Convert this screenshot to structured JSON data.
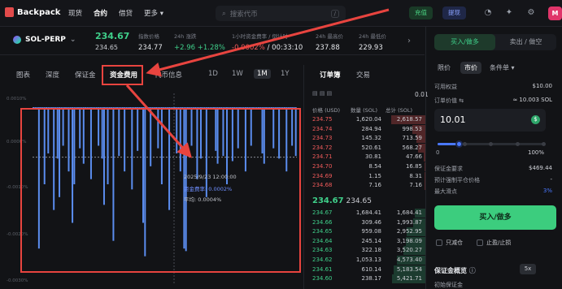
{
  "topbar": {
    "logo": "Backpack",
    "nav": [
      "现货",
      "合约",
      "借贷",
      "更多"
    ],
    "nav_active": 1,
    "search_placeholder": "搜索代币",
    "search_shortcut": "/",
    "deposit": "充值",
    "withdraw": "提现",
    "avatar": "M"
  },
  "market": {
    "symbol": "SOL-PERP",
    "last_price": "234.67",
    "mark_price": "234.65",
    "stats": [
      {
        "label": "指数价格",
        "value": "234.77",
        "tone": "normal"
      },
      {
        "label": "24h 涨跌",
        "value": "+2.96 +1.28%",
        "tone": "green"
      },
      {
        "label": "1小时资金费率 / 倒计时",
        "value": "-0.0002% / 00:33:10",
        "tone": "mixed"
      },
      {
        "label": "24h 最高价",
        "value": "237.88",
        "tone": "normal"
      },
      {
        "label": "24h 最低价",
        "value": "229.93",
        "tone": "normal"
      }
    ],
    "funding_rate": "-0.0002%",
    "countdown": "/ 00:33:10"
  },
  "chart_tabs": {
    "tabs": [
      "图表",
      "深度",
      "保证金",
      "资金费用",
      "代币信息"
    ],
    "active": 3,
    "timeframes": [
      "1D",
      "1W",
      "1M",
      "1Y"
    ],
    "active_tf": 2
  },
  "chart": {
    "y_labels": [
      "0.0010%",
      "0.0000%",
      "-0.0010%",
      "-0.0020%",
      "-0.0030%"
    ],
    "tooltip": {
      "date": "2025/9/23 12:00:00",
      "rate": "资金费率: 0.0002%",
      "avg": "平均: 0.0004%"
    }
  },
  "chart_data": {
    "type": "bar",
    "title": "",
    "xlabel": "",
    "ylabel": "",
    "ylim": [
      -0.005,
      0.001
    ],
    "baseline_note": "",
    "series": [
      {
        "values": [
          0.001,
          0.001,
          0.001,
          -0.0045,
          0.001,
          0.001,
          -0.002,
          0.001,
          -0.0008,
          0.001,
          0.001,
          -0.003,
          0.001,
          -0.001,
          -0.0025,
          0.001,
          -0.0005,
          0.001,
          0.001,
          -0.0015,
          0.001,
          -0.0035,
          -0.002,
          0.001,
          0.001,
          -0.0006,
          0.001,
          -0.0012,
          0.001,
          0.001,
          0.001,
          -0.0018,
          0.001,
          0.001,
          0.001,
          -0.0005,
          0.001,
          -0.001,
          -0.0028,
          0.001,
          -0.002,
          0.001,
          0.001,
          -0.0042,
          0.001,
          0.001,
          -0.0009,
          0.001,
          0.001,
          -0.0015,
          0.001,
          0.001,
          0.001,
          -0.0022,
          0.001,
          0.001,
          -0.0007,
          0.001,
          0.001,
          -0.0035,
          -0.0048,
          0.001,
          0.001,
          -0.0013,
          0.001,
          0.001,
          0.001,
          -0.0006,
          0.001,
          -0.002,
          0.001,
          0.001,
          0.001,
          -0.003,
          0.001,
          0.001,
          0.001,
          -0.0008,
          0.001,
          -0.0015,
          0.001,
          -0.0045,
          -0.0046,
          0.001,
          0.001,
          -0.0005,
          0.001,
          0.001,
          -0.0018,
          0.001,
          -0.001,
          0.001,
          0.001,
          -0.0025,
          0.001,
          0.001,
          0.001,
          0.001,
          -0.0007,
          -0.0012,
          0.001,
          0.001,
          -0.0009,
          0.001,
          -0.002,
          0.001,
          0.001,
          -0.0011,
          0.001,
          0.001,
          -0.0006,
          0.001,
          0.001,
          0.001,
          -0.0015,
          0.001,
          0.001,
          -0.0005,
          0.001,
          0.001,
          0.001,
          0.001,
          0.001,
          -0.0008,
          -0.0012,
          0.001,
          0.001,
          0.001,
          0.001,
          -0.0006,
          0.001,
          0.001,
          -0.001,
          0.001,
          0.001,
          0.001,
          -0.0015,
          0.001,
          0.001,
          -0.0005,
          0.001,
          -0.0009
        ]
      }
    ]
  },
  "orderbook": {
    "tabs": [
      "订单簿",
      "交易"
    ],
    "precision": "0.01",
    "headers": [
      "价格 (USD)",
      "数量 (SOL)",
      "总计 (SOL)"
    ],
    "asks": [
      {
        "price": "234.75",
        "qty": "1,620.04",
        "total": "2,618.57",
        "depth": 1.0
      },
      {
        "price": "234.74",
        "qty": "284.94",
        "total": "998.53",
        "depth": 0.38
      },
      {
        "price": "234.73",
        "qty": "145.32",
        "total": "713.59",
        "depth": 0.27
      },
      {
        "price": "234.72",
        "qty": "520.61",
        "total": "568.27",
        "depth": 0.22
      },
      {
        "price": "234.71",
        "qty": "30.81",
        "total": "47.66",
        "depth": 0.05
      },
      {
        "price": "234.70",
        "qty": "8.54",
        "total": "16.85",
        "depth": 0.03
      },
      {
        "price": "234.69",
        "qty": "1.15",
        "total": "8.31",
        "depth": 0.02
      },
      {
        "price": "234.68",
        "qty": "7.16",
        "total": "7.16",
        "depth": 0.02
      }
    ],
    "mid_price": "234.67",
    "mid_mark": "234.65",
    "bids": [
      {
        "price": "234.67",
        "qty": "1,684.41",
        "total": "1,684.41",
        "depth": 0.3
      },
      {
        "price": "234.66",
        "qty": "309.46",
        "total": "1,993.87",
        "depth": 0.36
      },
      {
        "price": "234.65",
        "qty": "959.08",
        "total": "2,952.95",
        "depth": 0.54
      },
      {
        "price": "234.64",
        "qty": "245.14",
        "total": "3,198.09",
        "depth": 0.58
      },
      {
        "price": "234.63",
        "qty": "322.18",
        "total": "3,520.27",
        "depth": 0.64
      },
      {
        "price": "234.62",
        "qty": "1,053.13",
        "total": "4,573.40",
        "depth": 0.83
      },
      {
        "price": "234.61",
        "qty": "610.14",
        "total": "5,183.54",
        "depth": 0.94
      },
      {
        "price": "234.60",
        "qty": "238.17",
        "total": "5,421.71",
        "depth": 0.98
      }
    ]
  },
  "order_panel": {
    "buy_tab": "买入/做多",
    "sell_tab": "卖出 / 做空",
    "types": [
      "限价",
      "市价",
      "条件单"
    ],
    "active_type": 1,
    "available_label": "可用权益",
    "available_value": "$10.00",
    "order_value_label": "订单价值",
    "order_value_approx": "≈ 10.003 SOL",
    "order_value": "10.01",
    "slider_value": 0.2,
    "slider_min": "0",
    "slider_max": "100%",
    "margin_req_label": "保证金要求",
    "margin_req_value": "$469.44",
    "liq_label": "预计强制平仓价格",
    "liq_value": "-",
    "slippage_label": "最大滑点",
    "slippage_value": "3%",
    "buy_button": "买入/做多",
    "reduce_only": "只减仓",
    "tp_sl": "止盈/止损",
    "margin_overview": "保证金概览",
    "leverage": "5x",
    "init_margin": "初始保证金"
  },
  "colors": {
    "accent_green": "#3fcf8a",
    "accent_red": "#ef5a5a",
    "bar_blue": "#5b8def",
    "highlight_red": "#e8443f"
  }
}
